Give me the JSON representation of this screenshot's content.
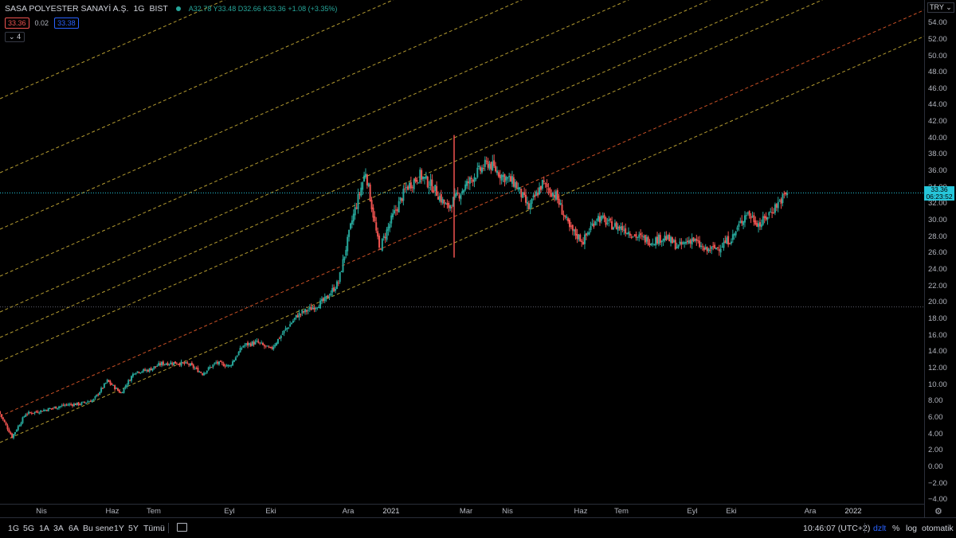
{
  "symbol": {
    "name": "SASA POLYESTER SANAYİ A.Ş.",
    "interval": "1G",
    "exchange": "BIST",
    "ohlc_open": "A32.78",
    "ohlc_high": "Y33.48",
    "ohlc_low": "D32.66",
    "ohlc_close": "K33.36",
    "change": "+1.08 (+3.35%)"
  },
  "price_row": {
    "sell": "33.36",
    "spread": "0.02",
    "buy": "33.38"
  },
  "indicator_count": "4",
  "currency_button": "TRY",
  "current_price": {
    "price": "33.36",
    "countdown": "06:23:52"
  },
  "colors": {
    "up": "#26a69a",
    "down": "#ef5350",
    "channel_yellow": "#d4b73a",
    "channel_orange": "#e05a2b",
    "current_line": "#26c6da",
    "background": "#000000"
  },
  "time_axis": [
    "Nis",
    "Haz",
    "Tem",
    "Eyl",
    "Eki",
    "Ara",
    "2021",
    "Mar",
    "Nis",
    "Haz",
    "Tem",
    "Eyl",
    "Eki",
    "Ara",
    "2022"
  ],
  "bottom": {
    "ranges": [
      "1G",
      "5G",
      "1A",
      "3A",
      "6A",
      "Bu sene",
      "1Y",
      "5Y",
      "Tümü"
    ],
    "time": "10:46:07 (UTC+2)",
    "adj": "dzlt",
    "percent": "%",
    "log": "log",
    "auto": "otomatik"
  },
  "chart_data": {
    "type": "candlestick",
    "y_ticks": [
      "54.00",
      "52.00",
      "50.00",
      "48.00",
      "46.00",
      "44.00",
      "42.00",
      "40.00",
      "38.00",
      "36.00",
      "34.00",
      "32.00",
      "30.00",
      "28.00",
      "26.00",
      "24.00",
      "22.00",
      "20.00",
      "18.00",
      "16.00",
      "14.00",
      "12.00",
      "10.00",
      "8.00",
      "6.00",
      "4.00",
      "2.00",
      "0.00",
      "−2.00",
      "−4.00"
    ],
    "ylim": [
      -4,
      56
    ],
    "log_scale": false,
    "current_price": 33.36,
    "close_path": [
      [
        "Mar 2020",
        6.8
      ],
      [
        "Nis 2020",
        3.7
      ],
      [
        "Nis 2020",
        6.5
      ],
      [
        "Nis 2020",
        6.8
      ],
      [
        "May 2020",
        7.2
      ],
      [
        "May 2020",
        7.6
      ],
      [
        "Haz 2020",
        7.7
      ],
      [
        "Haz 2020",
        8.2
      ],
      [
        "Haz 2020",
        10.5
      ],
      [
        "Tem 2020",
        9.0
      ],
      [
        "Tem 2020",
        11.6
      ],
      [
        "Tem 2020",
        11.8
      ],
      [
        "Ağu 2020",
        12.6
      ],
      [
        "Eyl 2020",
        12.7
      ],
      [
        "Eyl 2020",
        12.5
      ],
      [
        "Eki 2020",
        11.4
      ],
      [
        "Eki 2020",
        12.7
      ],
      [
        "Kas 2020",
        12.3
      ],
      [
        "Kas 2020",
        14.8
      ],
      [
        "Ara 2020",
        15.2
      ],
      [
        "Ara 2020",
        14.3
      ],
      [
        "Ara 2020",
        16.5
      ],
      [
        "Oca 2021",
        18.5
      ],
      [
        "Oca 2021",
        19.3
      ],
      [
        "Oca 2021",
        20.3
      ],
      [
        "Şub 2021",
        22.5
      ],
      [
        "Şub 2021",
        30.0
      ],
      [
        "Şub 2021",
        36.0
      ],
      [
        "Şub 2021",
        26.5
      ],
      [
        "Mar 2021",
        30.5
      ],
      [
        "Mar 2021",
        34.0
      ],
      [
        "Mar 2021",
        35.5
      ],
      [
        "Nis 2021",
        34.0
      ],
      [
        "Nis 2021",
        31.5
      ],
      [
        "Nis 2021",
        33.5
      ],
      [
        "Nis 2021",
        35.5
      ],
      [
        "May 2021",
        37.0
      ],
      [
        "May 2021",
        35.5
      ],
      [
        "May 2021",
        34.5
      ],
      [
        "Haz 2021",
        31.5
      ],
      [
        "Haz 2021",
        34.5
      ],
      [
        "Haz 2021",
        33.0
      ],
      [
        "Haz 2021",
        29.0
      ],
      [
        "Tem 2021",
        27.5
      ],
      [
        "Tem 2021",
        30.5
      ],
      [
        "Tem 2021",
        29.5
      ],
      [
        "Ağu 2021",
        29.0
      ],
      [
        "Ağu 2021",
        28.0
      ],
      [
        "Ağu 2021",
        27.5
      ],
      [
        "Eyl 2021",
        28.0
      ],
      [
        "Eyl 2021",
        26.8
      ],
      [
        "Eyl 2021",
        27.8
      ],
      [
        "Eki 2021",
        26.3
      ],
      [
        "Eki 2021",
        26.8
      ],
      [
        "Eki 2021",
        28.0
      ],
      [
        "Eki 2021",
        31.0
      ],
      [
        "Kas 2021",
        29.5
      ],
      [
        "Kas 2021",
        31.5
      ],
      [
        "Kas 2021",
        33.36
      ]
    ]
  }
}
